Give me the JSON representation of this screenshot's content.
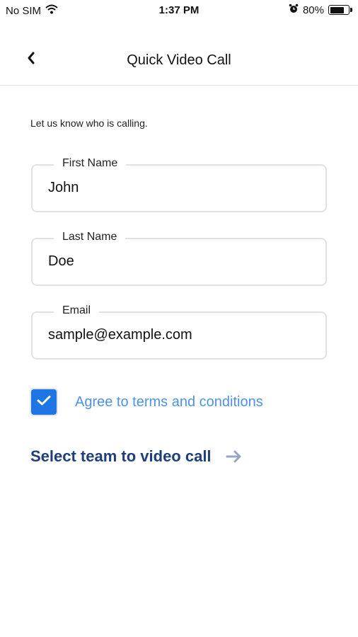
{
  "status_bar": {
    "carrier": "No SIM",
    "time": "1:37 PM",
    "battery_percent": "80%",
    "battery_level": 0.8,
    "icons": [
      "wifi-icon",
      "alarm-icon",
      "battery-icon"
    ]
  },
  "nav": {
    "title": "Quick Video Call",
    "back_icon": "chevron-left-icon"
  },
  "form": {
    "intro": "Let us know who is calling.",
    "first_name": {
      "label": "First Name",
      "value": "John"
    },
    "last_name": {
      "label": "Last Name",
      "value": "Doe"
    },
    "email": {
      "label": "Email",
      "value": "sample@example.com"
    },
    "terms": {
      "label": "Agree to terms and conditions",
      "checked": true
    }
  },
  "cta": {
    "label": "Select team to video call",
    "icon": "arrow-right-icon"
  },
  "colors": {
    "accent": "#1d76e3",
    "link": "#4d92e6",
    "cta_text": "#1f3f7a",
    "cta_arrow": "#97a6bf",
    "field_border": "#e1e1e1"
  }
}
